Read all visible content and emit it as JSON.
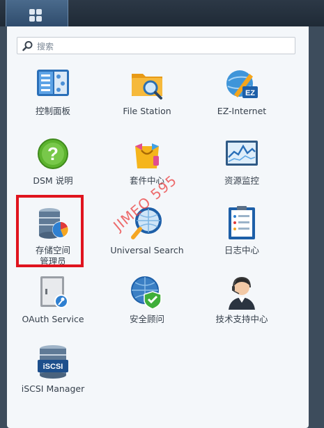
{
  "search": {
    "placeholder": "搜索"
  },
  "apps": [
    {
      "label": "控制面板"
    },
    {
      "label": "File Station"
    },
    {
      "label": "EZ-Internet"
    },
    {
      "label": "DSM 说明"
    },
    {
      "label": "套件中心"
    },
    {
      "label": "资源监控"
    },
    {
      "label": "存储空间\n管理员"
    },
    {
      "label": "Universal Search"
    },
    {
      "label": "日志中心"
    },
    {
      "label": "OAuth Service"
    },
    {
      "label": "安全顾问"
    },
    {
      "label": "技术支持中心"
    },
    {
      "label": "iSCSI Manager"
    }
  ],
  "icon_text": {
    "ez": "EZ",
    "iscsi": "iSCSI",
    "help": "?"
  },
  "watermark": "JIMEO 595",
  "colors": {
    "highlight": "#e0141e",
    "topbar_active": "#3b5b7e",
    "panel": "#f4f7fa"
  }
}
